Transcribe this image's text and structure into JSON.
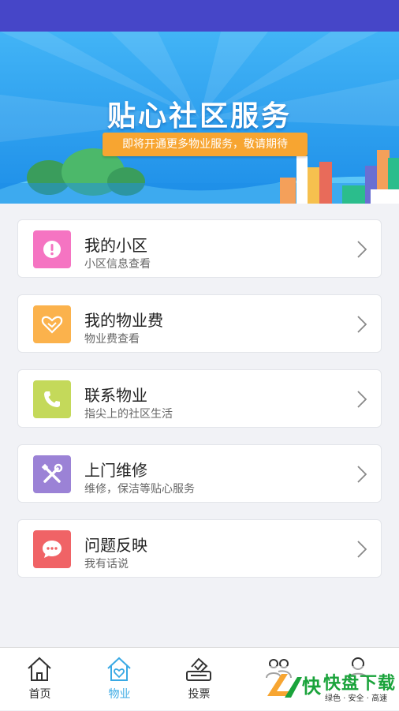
{
  "banner": {
    "title": "贴心社区服务",
    "subtitle": "即将开通更多物业服务，敬请期待"
  },
  "menu": [
    {
      "title": "我的小区",
      "subtitle": "小区信息查看",
      "icon": "alert-icon",
      "color": "#f574c2"
    },
    {
      "title": "我的物业费",
      "subtitle": "物业费查看",
      "icon": "handshake-icon",
      "color": "#fbb24c"
    },
    {
      "title": "联系物业",
      "subtitle": "指尖上的社区生活",
      "icon": "phone-icon",
      "color": "#c4d95a"
    },
    {
      "title": "上门维修",
      "subtitle": "维修，保洁等贴心服务",
      "icon": "tools-icon",
      "color": "#9b82d6"
    },
    {
      "title": "问题反映",
      "subtitle": "我有话说",
      "icon": "chat-bubble-icon",
      "color": "#f06366"
    }
  ],
  "tabs": [
    {
      "label": "首页",
      "icon": "home-icon"
    },
    {
      "label": "物业",
      "icon": "property-icon",
      "active": true
    },
    {
      "label": "投票",
      "icon": "vote-icon"
    },
    {
      "label": "",
      "icon": "community-icon"
    },
    {
      "label": "",
      "icon": "user-icon"
    }
  ],
  "watermark": {
    "brand": "快盘下载",
    "tagline": "绿色 · 安全 · 高速"
  },
  "colors": {
    "status_bar": "#4646c8",
    "banner": "#2a9df0",
    "accent": "#39a9e4",
    "ribbon": "#f7a531"
  }
}
